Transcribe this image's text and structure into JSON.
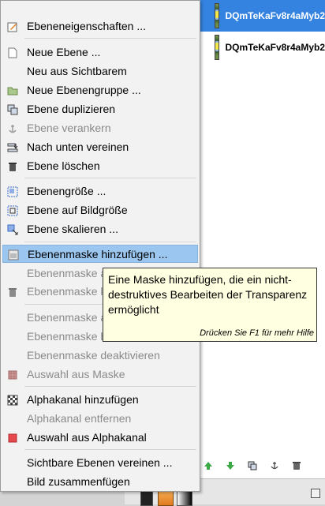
{
  "layers": {
    "items": [
      {
        "name": "DQmTeKaFv8r4aMyb2",
        "selected": true
      },
      {
        "name": "DQmTeKaFv8r4aMyb2",
        "selected": false
      }
    ]
  },
  "menu": {
    "items": [
      {
        "label": "Ebeneneigenschaften ...",
        "icon": "layer-properties-icon",
        "enabled": true
      },
      {
        "label": "Neue Ebene ...",
        "icon": "new-layer-icon",
        "enabled": true
      },
      {
        "label": "Neu aus Sichtbarem",
        "icon": "",
        "enabled": true
      },
      {
        "label": "Neue Ebenengruppe ...",
        "icon": "folder-icon",
        "enabled": true
      },
      {
        "label": "Ebene duplizieren",
        "icon": "duplicate-icon",
        "enabled": true
      },
      {
        "label": "Ebene verankern",
        "icon": "anchor-icon",
        "enabled": false
      },
      {
        "label": "Nach unten vereinen",
        "icon": "merge-down-icon",
        "enabled": true
      },
      {
        "label": "Ebene löschen",
        "icon": "trash-icon",
        "enabled": true
      },
      {
        "label": "Ebenengröße ...",
        "icon": "layer-size-icon",
        "enabled": true
      },
      {
        "label": "Ebene auf Bildgröße",
        "icon": "layer-to-image-size-icon",
        "enabled": true
      },
      {
        "label": "Ebene skalieren ...",
        "icon": "scale-icon",
        "enabled": true
      },
      {
        "label": "Ebenenmaske hinzufügen ...",
        "icon": "add-mask-icon",
        "enabled": true,
        "highlighted": true
      },
      {
        "label": "Ebenenmaske a",
        "icon": "",
        "enabled": false
      },
      {
        "label": "Ebenenmaske l",
        "icon": "trash-icon",
        "enabled": false
      },
      {
        "label": "Ebenenmaske a",
        "icon": "",
        "enabled": false
      },
      {
        "label": "Ebenenmaske b",
        "icon": "",
        "enabled": false
      },
      {
        "label": "Ebenenmaske deaktivieren",
        "icon": "",
        "enabled": false
      },
      {
        "label": "Auswahl aus Maske",
        "icon": "mask-selection-icon",
        "enabled": false
      },
      {
        "label": "Alphakanal hinzufügen",
        "icon": "alpha-icon",
        "enabled": true
      },
      {
        "label": "Alphakanal entfernen",
        "icon": "",
        "enabled": false
      },
      {
        "label": "Auswahl aus Alphakanal",
        "icon": "alpha-selection-icon",
        "enabled": true
      },
      {
        "label": "Sichtbare Ebenen vereinen ...",
        "icon": "",
        "enabled": true
      },
      {
        "label": "Bild zusammenfügen",
        "icon": "",
        "enabled": true
      }
    ]
  },
  "tooltip": {
    "text": "Eine Maske hinzufügen, die ein nicht-\ndestruktives Bearbeiten der Transparenz\nermöglicht",
    "help": "Drücken Sie F1 für mehr Hilfe"
  },
  "colors": {
    "highlight": "#9bc6ef",
    "selected_layer": "#3483e0",
    "tooltip_bg": "#ffffe1",
    "disabled_text": "#8a8a8a"
  }
}
